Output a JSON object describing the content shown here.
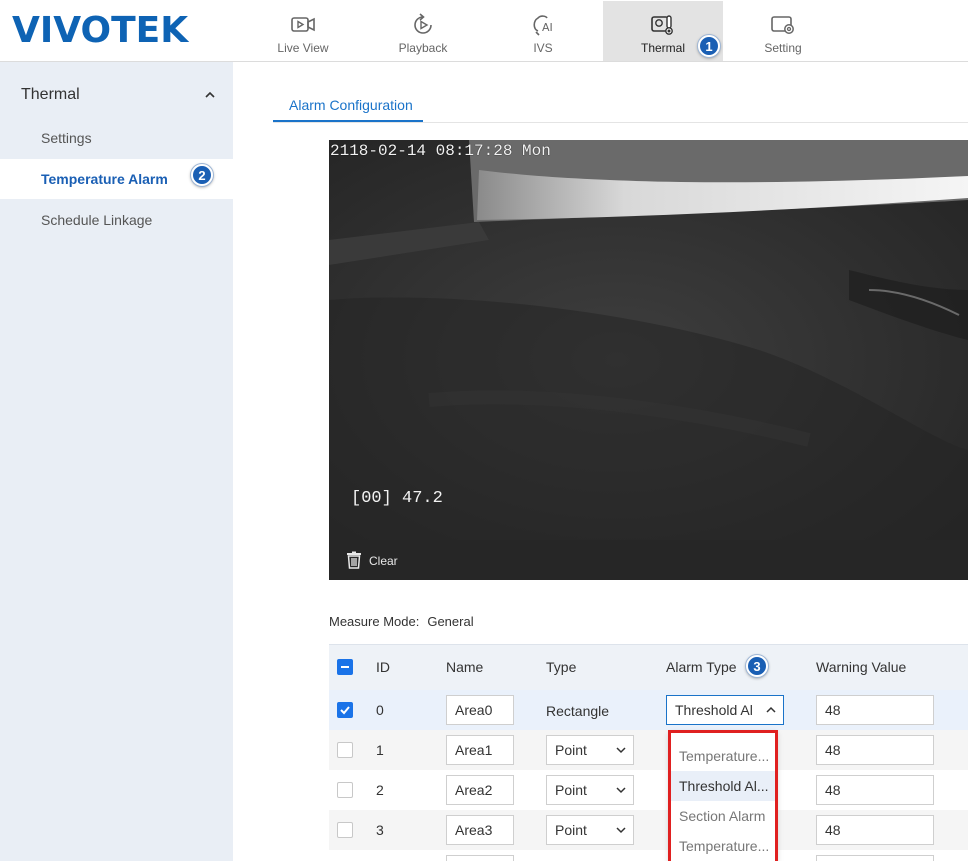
{
  "logo": "VIVOTEK",
  "nav": {
    "tabs": [
      {
        "label": "Live View",
        "icon": "live-view-icon"
      },
      {
        "label": "Playback",
        "icon": "playback-icon"
      },
      {
        "label": "IVS",
        "icon": "ivs-icon"
      },
      {
        "label": "Thermal",
        "icon": "thermal-icon",
        "active": true
      },
      {
        "label": "Setting",
        "icon": "setting-icon"
      }
    ]
  },
  "badges": {
    "b1": "1",
    "b2": "2",
    "b3": "3"
  },
  "sidebar": {
    "title": "Thermal",
    "items": [
      {
        "label": "Settings"
      },
      {
        "label": "Temperature Alarm",
        "active": true
      },
      {
        "label": "Schedule Linkage"
      }
    ]
  },
  "subtab": {
    "label": "Alarm Configuration"
  },
  "video": {
    "timestamp": "2118-02-14 08:17:28 Mon",
    "reading": "[00] 47.2",
    "clear_label": "Clear"
  },
  "measure": {
    "label": "Measure Mode:",
    "value": "General"
  },
  "table": {
    "headers": {
      "id": "ID",
      "name": "Name",
      "type": "Type",
      "alarm_type": "Alarm Type",
      "warning_value": "Warning Value"
    },
    "rows": [
      {
        "id": "0",
        "name": "Area0",
        "type": "Rectangle",
        "alarm_type": "Threshold Al",
        "warning": "48",
        "checked": true
      },
      {
        "id": "1",
        "name": "Area1",
        "type": "Point",
        "warning": "48",
        "checked": false
      },
      {
        "id": "2",
        "name": "Area2",
        "type": "Point",
        "warning": "48",
        "checked": false
      },
      {
        "id": "3",
        "name": "Area3",
        "type": "Point",
        "warning": "48",
        "checked": false
      }
    ]
  },
  "alarm_dropdown": {
    "options": [
      "Temperature...",
      "Threshold Al...",
      "Section Alarm",
      "Temperature..."
    ],
    "highlighted_index": 1
  },
  "colors": {
    "brand": "#0e63b4",
    "accent": "#1a73c9",
    "highlight_frame": "#e02020",
    "badge": "#1a5fb4"
  }
}
